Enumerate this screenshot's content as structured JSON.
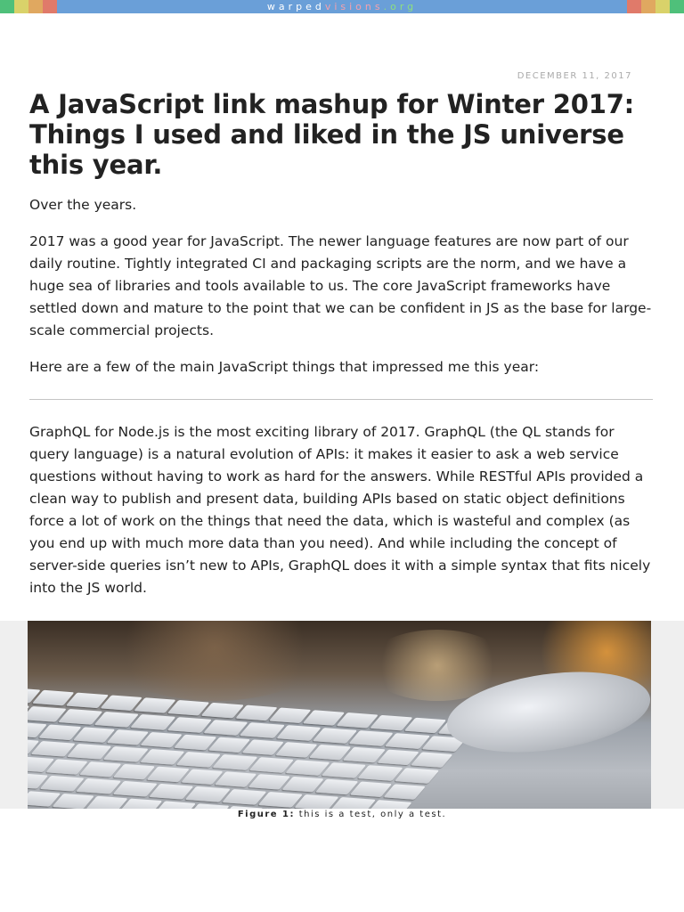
{
  "header": {
    "logo_part1": "warped",
    "logo_part2": "visions",
    "logo_part3": ".org",
    "bar_color": "#6a9fd8",
    "stripe_colors_left": [
      "#4fc07a",
      "#d9d26a",
      "#e0a860",
      "#e07a6a"
    ],
    "stripe_colors_right": [
      "#e07a6a",
      "#e0a860",
      "#d9d26a",
      "#4fc07a"
    ]
  },
  "article": {
    "date": "DECEMBER 11, 2017",
    "title": "A JavaScript link mashup for Winter 2017: Things I used and liked in the JS universe this year.",
    "intro": "Over the years.",
    "paragraph_1": "2017 was a good year for JavaScript. The newer language features are now part of our daily routine. Tightly integrated CI and packaging scripts are the norm, and we have a huge sea of libraries and tools available to us. The core JavaScript frameworks have settled down and mature to the point that we can be confident in JS as the base for large-scale commercial projects.",
    "paragraph_2": "Here are a few of the main JavaScript things that impressed me this year:",
    "paragraph_3": "GraphQL for Node.js is the most exciting library of 2017. GraphQL (the QL stands for query language) is a natural evolution of APIs: it makes it easier to ask a web service questions without having to work as hard for the answers. While RESTful APIs provided a clean way to publish and present data, building APIs based on static object definitions force a lot of work on the things that need the data, which is wasteful and complex (as you end up with much more data than you need). And while including the concept of server-side queries isn’t new to APIs, GraphQL does it with a simple syntax that fits nicely into the JS world."
  },
  "figure": {
    "image_subject": "keyboard-and-mouse-photo",
    "caption_label": "Figure 1:",
    "caption_text": " this is a test, only a test."
  }
}
